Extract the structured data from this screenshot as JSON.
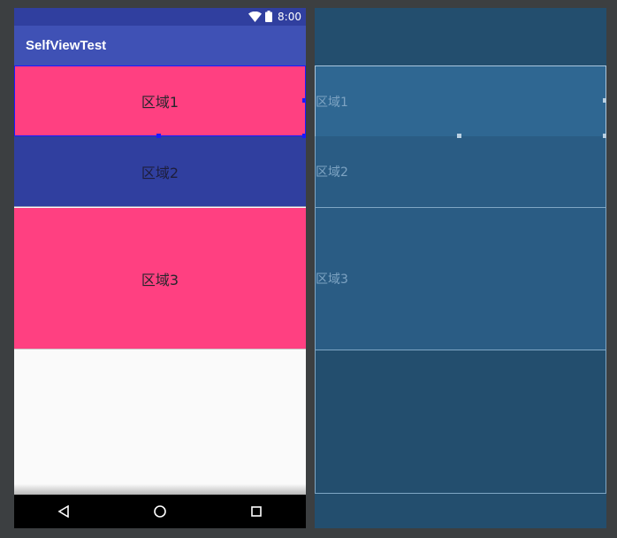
{
  "status_bar": {
    "time": "8:00",
    "icons": [
      "wifi-icon",
      "battery-icon"
    ]
  },
  "app_bar": {
    "title": "SelfViewTest"
  },
  "regions": [
    {
      "label": "区域1",
      "color": "#ff4081"
    },
    {
      "label": "区域2",
      "color": "#303f9f"
    },
    {
      "label": "区域3",
      "color": "#ff4081"
    }
  ],
  "nav_bar": {
    "icons": [
      "back-icon",
      "home-icon",
      "recents-icon"
    ]
  },
  "blueprint": {
    "labels": [
      "区域1",
      "区域2",
      "区域3"
    ],
    "background": "#234e6e"
  },
  "colors": {
    "primary": "#3f51b5",
    "primary_dark": "#303f9f",
    "accent": "#ff4081",
    "editor_bg": "#3c3f41"
  }
}
